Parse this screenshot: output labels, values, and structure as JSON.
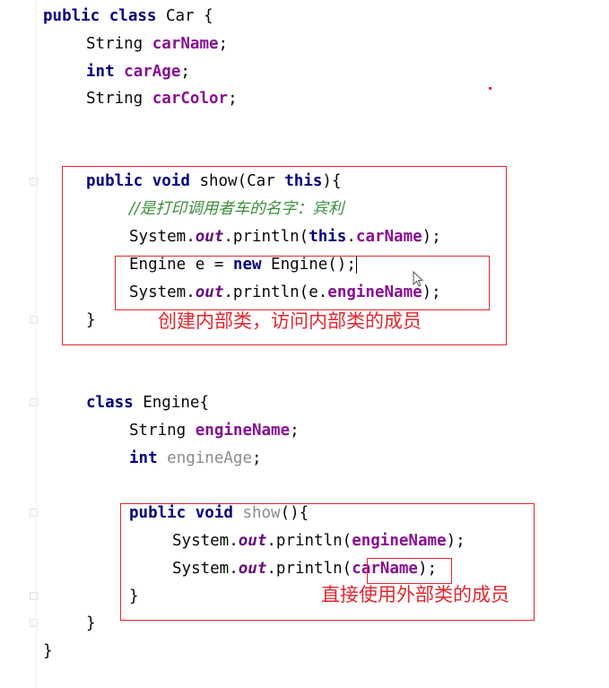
{
  "code": {
    "l1": {
      "kw": "public class",
      "rest": " Car {"
    },
    "l2": {
      "type": "String ",
      "field": "carName",
      "end": ";"
    },
    "l3": {
      "kw": "int",
      "sp": " ",
      "field": "carAge",
      "end": ";"
    },
    "l4": {
      "type": "String ",
      "field": "carColor",
      "end": ";"
    },
    "l5": {
      "kw": "public void",
      "mid": " show(Car ",
      "kw2": "this",
      "end": "){"
    },
    "l6": {
      "comment": "//是打印调用者车的名字：宾利"
    },
    "l7": {
      "a": "System.",
      "static": "out",
      "b": ".println(",
      "kw": "this",
      "c": ".",
      "field": "carName",
      "end": ");"
    },
    "l8": {
      "a": "Engine e = ",
      "kw": "new",
      "b": " Engine();"
    },
    "l9": {
      "a": "System.",
      "static": "out",
      "b": ".println(e.",
      "field": "engineName",
      "end": ");"
    },
    "l10": {
      "text": "}"
    },
    "l11": {
      "kw": "class",
      "rest": " Engine{"
    },
    "l12": {
      "type": "String ",
      "field": "engineName",
      "end": ";"
    },
    "l13": {
      "kw": "int",
      "sp": " ",
      "field": "engineAge",
      "end": ";"
    },
    "l14": {
      "kw": "public void",
      "sp": " ",
      "name": "show",
      "end": "(){"
    },
    "l15": {
      "a": "System.",
      "static": "out",
      "b": ".println(",
      "field": "engineName",
      "end": ");"
    },
    "l16": {
      "a": "System.",
      "static": "out",
      "b": ".println(",
      "field": "carName",
      "end": ");"
    },
    "l17": {
      "text": "}"
    },
    "l18": {
      "text": "}"
    },
    "l19": {
      "text": "}"
    }
  },
  "annotations": {
    "note1": "创建内部类，访问内部类的成员",
    "note2": "直接使用外部类的成员"
  },
  "colors": {
    "annotation": "#e3262e",
    "keyword": "#000080",
    "field": "#871094"
  }
}
